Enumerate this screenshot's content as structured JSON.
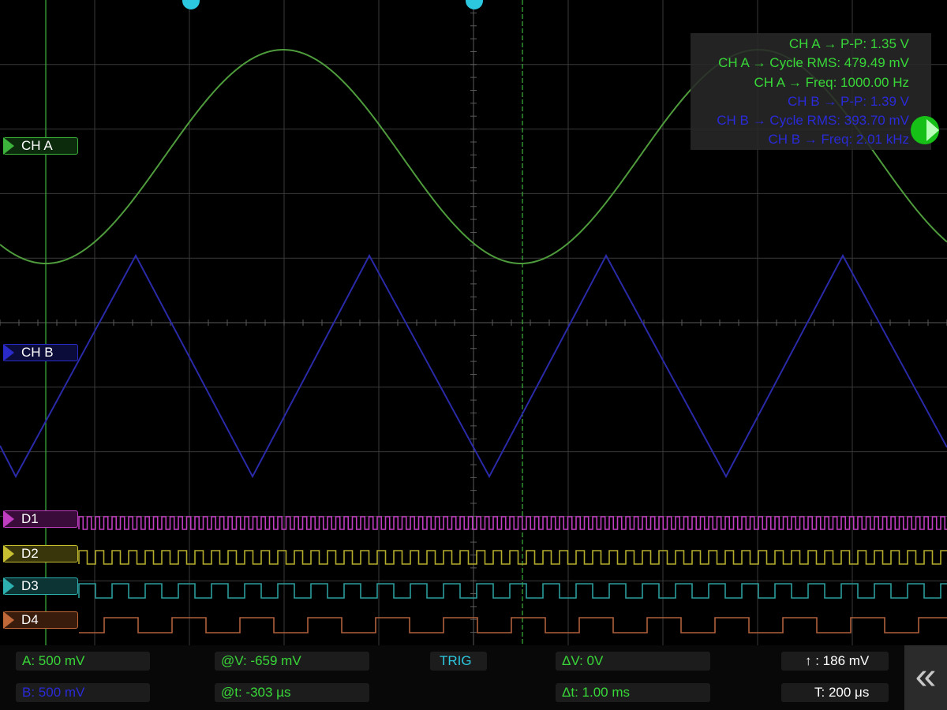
{
  "colors": {
    "ch_a": "#4e9c3c",
    "ch_b": "#2a2aa8",
    "d1": "#c03cc0",
    "d2": "#b4ac2c",
    "d3": "#2c9c9c",
    "d4": "#b0603c",
    "grid": "#3a3a3a",
    "cursor": "#3cb43c",
    "trigger_marker": "#2cc8e0"
  },
  "channels": {
    "ch_a": {
      "label": "CH A"
    },
    "ch_b": {
      "label": "CH B"
    },
    "d1": {
      "label": "D1"
    },
    "d2": {
      "label": "D2"
    },
    "d3": {
      "label": "D3"
    },
    "d4": {
      "label": "D4"
    }
  },
  "measurements": {
    "a_pp": "CH A → P-P: 1.35 V",
    "a_rms": "CH A → Cycle RMS: 479.49 mV",
    "a_freq": "CH A → Freq: 1000.00 Hz",
    "b_pp": "CH B → P-P: 1.39 V",
    "b_rms": "CH B → Cycle RMS: 393.70 mV",
    "b_freq": "CH B → Freq: 2.01 kHz"
  },
  "bottom_bar": {
    "scale_a": "A: 500 mV",
    "scale_b": "B: 500 mV",
    "at_v": "@V: -659 mV",
    "at_t": "@t: -303 µs",
    "trig": "TRIG",
    "delta_v": "ΔV: 0V",
    "delta_t": "Δt: 1.00 ms",
    "trig_level": "↑ : 186 mV",
    "timebase": "T: 200 μs",
    "collapse_icon": "«"
  },
  "icons": {
    "trigger_side": "trigger-level-icon",
    "trigger_top": "trigger-position-icon",
    "collapse": "double-chevron-left-icon"
  }
}
